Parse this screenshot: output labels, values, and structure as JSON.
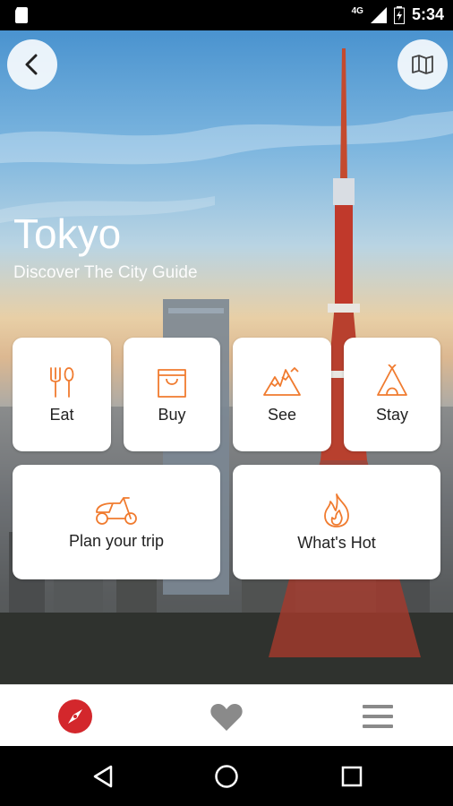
{
  "status_bar": {
    "network": "4G",
    "time": "5:34"
  },
  "hero": {
    "title": "Tokyo",
    "subtitle": "Discover The City Guide"
  },
  "toolbar": {
    "back_icon": "chevron-left-icon",
    "map_icon": "map-icon"
  },
  "categories": [
    {
      "label": "Eat",
      "icon": "fork-spoon-icon"
    },
    {
      "label": "Buy",
      "icon": "shopping-bag-icon"
    },
    {
      "label": "See",
      "icon": "mountains-icon"
    },
    {
      "label": "Stay",
      "icon": "tent-icon"
    }
  ],
  "actions": [
    {
      "label": "Plan your trip",
      "icon": "scooter-icon"
    },
    {
      "label": "What's Hot",
      "icon": "flame-icon"
    }
  ],
  "bottom_nav": [
    {
      "icon": "compass-icon",
      "active": true
    },
    {
      "icon": "heart-icon",
      "active": false
    },
    {
      "icon": "menu-icon",
      "active": false
    }
  ],
  "colors": {
    "accent": "#f07b2f",
    "active_nav": "#d3272c",
    "inactive_nav": "#8a8a8a"
  }
}
